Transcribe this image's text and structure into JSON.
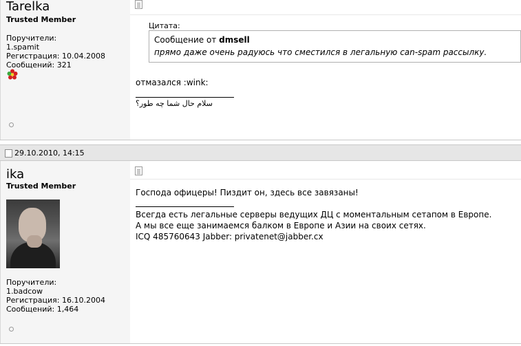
{
  "post1": {
    "username": "Tarelka",
    "user_title": "Trusted Member",
    "info": [
      "Поручители:",
      "1.spamit",
      "Регистрация: 10.04.2008",
      "Сообщений: 321"
    ],
    "status_icon": "icq-flower-icon",
    "quote_label": "Цитата:",
    "quote_prefix": "Сообщение от",
    "quote_author": "dmsell",
    "quote_text": "прямо даже очень радуюсь что сместился в легальную can-spam рассылку.",
    "message": "отмазался :wink:",
    "signature": "سلام حال شما چه طور؟"
  },
  "post2": {
    "date": "29.10.2010, 14:15",
    "username": "ika",
    "user_title": "Trusted Member",
    "info": [
      "Поручители:",
      "1.badcow",
      "Регистрация: 16.10.2004",
      "Сообщений: 1,464"
    ],
    "message": "Господа офицеры! Пиздит он, здесь все завязаны!",
    "signature": [
      "Всегда есть легальные серверы ведущих ДЦ с моментальным сетапом в Европе.",
      "А мы все еще занимаемся балком в Европе и Азии на своих сетях.",
      "ICQ 485760643 Jabber: privatenet@jabber.cx"
    ]
  }
}
